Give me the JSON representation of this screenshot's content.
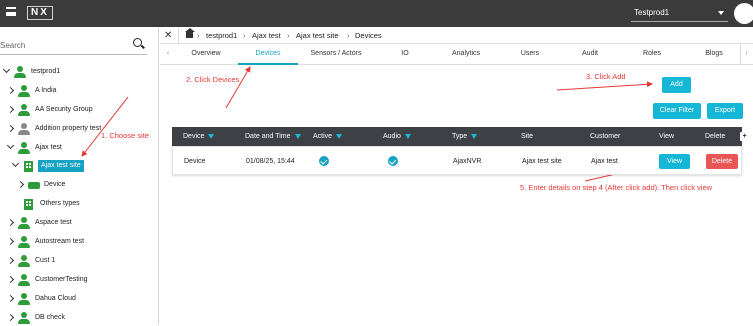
{
  "header": {
    "logo": "NX",
    "tenant": "Testprod1"
  },
  "sidebar": {
    "search_placeholder": "Search",
    "tree": [
      {
        "label": "testprod1"
      },
      {
        "label": "A India"
      },
      {
        "label": "AA Security Group"
      },
      {
        "label": "Addition property test"
      },
      {
        "label": "Ajax test"
      },
      {
        "label": "Ajax test site"
      },
      {
        "label": "Device"
      },
      {
        "label": "Others types"
      },
      {
        "label": "Aspace test"
      },
      {
        "label": "Autostream test"
      },
      {
        "label": "Cust 1"
      },
      {
        "label": "CustomerTesting"
      },
      {
        "label": "Dahua Cloud"
      },
      {
        "label": "DB check"
      }
    ]
  },
  "breadcrumb": {
    "items": [
      "testprod1",
      "Ajax test",
      "Ajax test site",
      "Devices"
    ]
  },
  "tabs": [
    "Overview",
    "Devices",
    "Sensors / Actors",
    "IO",
    "Analytics",
    "Users",
    "Audit",
    "Roles",
    "Blogs"
  ],
  "buttons": {
    "add": "Add",
    "clear_filter": "Clear Filter",
    "export": "Export"
  },
  "table": {
    "headers": [
      "Device",
      "Date and Time",
      "Active",
      "Audio",
      "Type",
      "Site",
      "Customer",
      "View",
      "Delete"
    ],
    "rows": [
      {
        "device": "Device",
        "datetime": "01/08/25, 15:44",
        "active": true,
        "audio": true,
        "type": "AjaxNVR",
        "site": "Ajax test site",
        "customer": "Ajax test",
        "view": "View",
        "delete": "Delete"
      }
    ]
  },
  "annotations": {
    "step1": "1. Choose site",
    "step2": "2. Click Devices",
    "step3": "3. Click Add",
    "step5": "5. Enter details on step 4 (After click add). Then click view"
  },
  "colors": {
    "accent": "#15a2c3",
    "annotation": "#e53935",
    "delete": "#e85656",
    "tree_icon": "#2e9c3a"
  }
}
